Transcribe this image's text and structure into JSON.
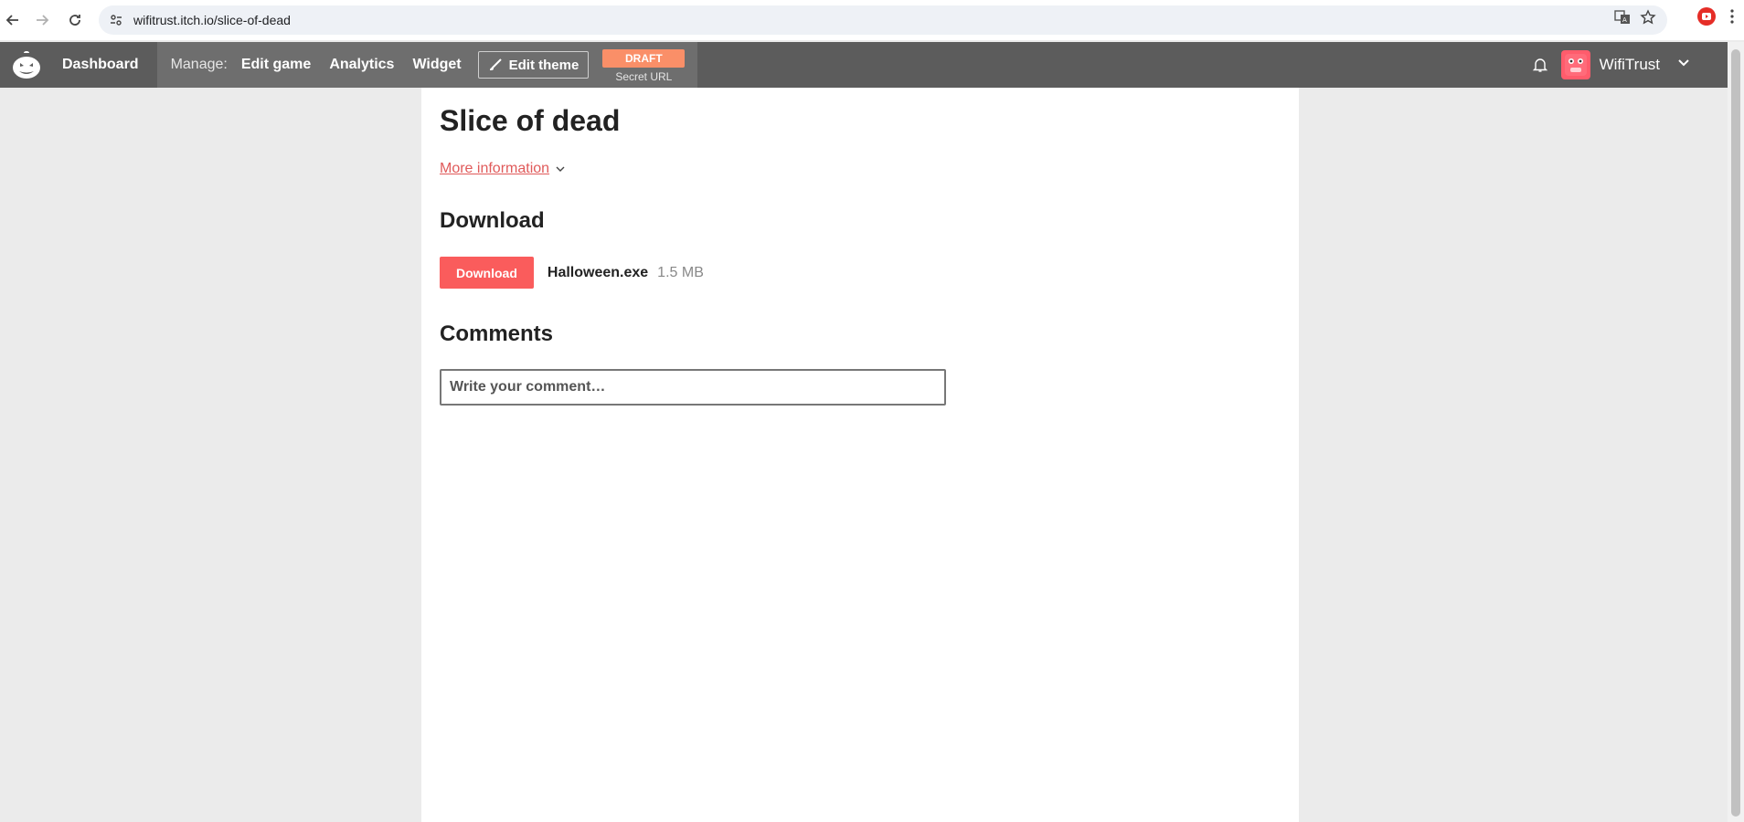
{
  "browser": {
    "url": "wifitrust.itch.io/slice-of-dead"
  },
  "header": {
    "dashboard": "Dashboard",
    "manage_label": "Manage:",
    "edit_game": "Edit game",
    "analytics": "Analytics",
    "widget": "Widget",
    "edit_theme": "Edit theme",
    "draft": "DRAFT",
    "secret_url": "Secret URL",
    "username": "WifiTrust"
  },
  "game": {
    "title": "Slice of dead",
    "more_info": "More information"
  },
  "download": {
    "heading": "Download",
    "button": "Download",
    "file_name": "Halloween.exe",
    "file_size": "1.5 MB"
  },
  "comments": {
    "heading": "Comments",
    "placeholder": "Write your comment…"
  },
  "colors": {
    "accent": "#fa5c5c",
    "header_bg": "#5c5c5c",
    "draft_badge": "#fa8f68",
    "page_bg": "#ebebeb"
  }
}
